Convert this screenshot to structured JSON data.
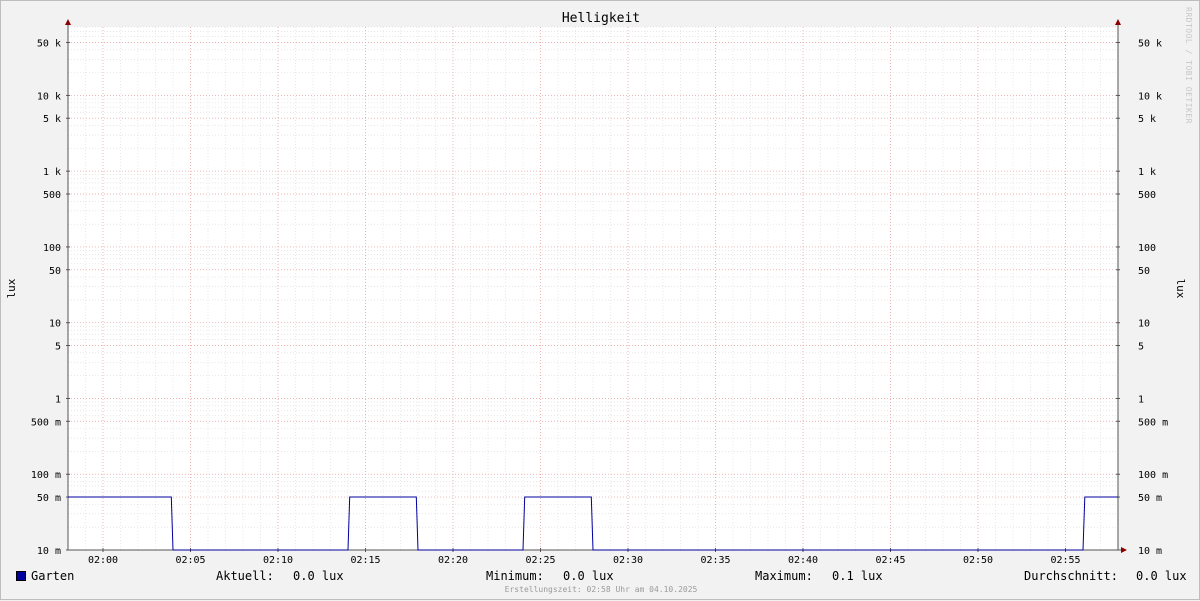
{
  "chart_data": {
    "type": "line",
    "title": "Helligkeit",
    "ylabel_left": "lux",
    "ylabel_right": "lux",
    "yscale": "log",
    "ylim": [
      0.01,
      80000
    ],
    "y_ticks": [
      {
        "value": 50000,
        "label": "50 k"
      },
      {
        "value": 10000,
        "label": "10 k"
      },
      {
        "value": 5000,
        "label": "5 k"
      },
      {
        "value": 1000,
        "label": "1 k"
      },
      {
        "value": 500,
        "label": "500"
      },
      {
        "value": 100,
        "label": "100"
      },
      {
        "value": 50,
        "label": "50"
      },
      {
        "value": 10,
        "label": "10"
      },
      {
        "value": 5,
        "label": "5"
      },
      {
        "value": 1,
        "label": "1"
      },
      {
        "value": 0.5,
        "label": "500 m"
      },
      {
        "value": 0.1,
        "label": "100 m"
      },
      {
        "value": 0.05,
        "label": "50 m"
      },
      {
        "value": 0.01,
        "label": "10 m"
      }
    ],
    "x_ticks": [
      "02:00",
      "02:05",
      "02:10",
      "02:15",
      "02:20",
      "02:25",
      "02:30",
      "02:35",
      "02:40",
      "02:45",
      "02:50",
      "02:55"
    ],
    "xlim": [
      "01:58",
      "02:58"
    ],
    "grid": true,
    "series": [
      {
        "name": "Garten",
        "color": "#00009f",
        "points": [
          [
            "01:58",
            0.05
          ],
          [
            "02:03.9",
            0.05
          ],
          [
            "02:04",
            0.01
          ],
          [
            "02:14",
            0.01
          ],
          [
            "02:14.1",
            0.05
          ],
          [
            "02:17.9",
            0.05
          ],
          [
            "02:18",
            0.01
          ],
          [
            "02:24",
            0.01
          ],
          [
            "02:24.1",
            0.05
          ],
          [
            "02:27.9",
            0.05
          ],
          [
            "02:28",
            0.01
          ],
          [
            "02:56",
            0.01
          ],
          [
            "02:56.1",
            0.05
          ],
          [
            "02:58",
            0.05
          ]
        ]
      }
    ]
  },
  "legend": {
    "series_name": "Garten",
    "aktuell_label": "Aktuell:",
    "aktuell_value": "0.0 lux",
    "minimum_label": "Minimum:",
    "minimum_value": "0.0 lux",
    "maximum_label": "Maximum:",
    "maximum_value": "0.1 lux",
    "durchschnitt_label": "Durchschnitt:",
    "durchschnitt_value": "0.0 lux"
  },
  "watermark": "RRDTOOL / TOBI OETIKER",
  "footer": "Erstellungszeit: 02:58 Uhr am 04.10.2025"
}
